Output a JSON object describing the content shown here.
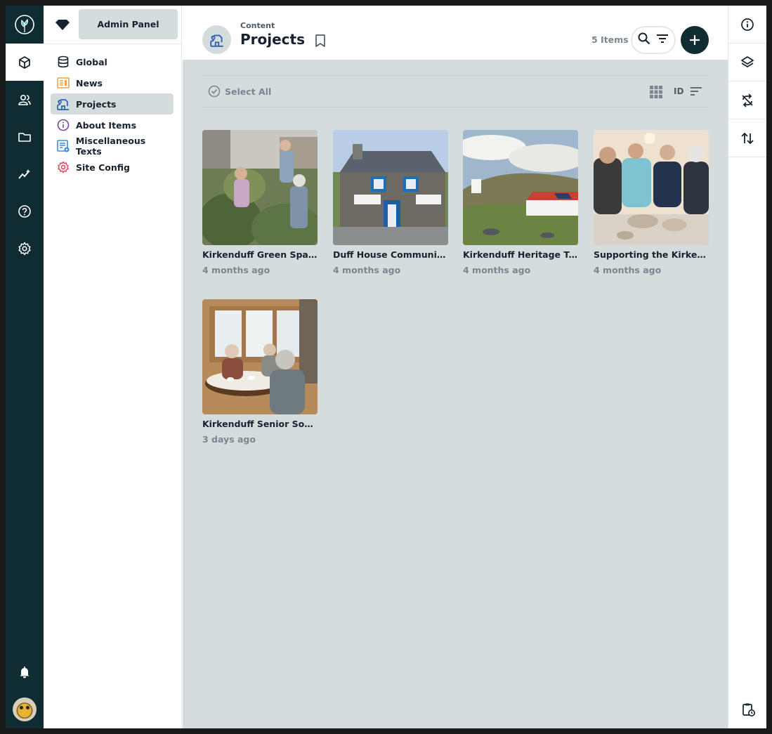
{
  "nav": {
    "admin_button": "Admin Panel",
    "items": [
      {
        "label": "Global",
        "icon": "database-icon",
        "color": "#18222f"
      },
      {
        "label": "News",
        "icon": "newspaper-icon",
        "color": "#f0a442"
      },
      {
        "label": "Projects",
        "icon": "projects-icon",
        "color": "#2b62b5",
        "active": true
      },
      {
        "label": "About Items",
        "icon": "info-icon",
        "color": "#7b4a8e"
      },
      {
        "label": "Miscellaneous Texts",
        "icon": "article-icon",
        "color": "#3a8ee0"
      },
      {
        "label": "Site Config",
        "icon": "gear-icon",
        "color": "#e0455f"
      }
    ]
  },
  "header": {
    "breadcrumb": "Content",
    "title": "Projects",
    "item_count": "5 Items"
  },
  "toolbar": {
    "select_all": "Select All",
    "sort_field": "ID"
  },
  "cards": [
    {
      "name": "Kirkenduff Green Spac...",
      "date": "4 months ago",
      "scene": "garden"
    },
    {
      "name": "Duff House Community...",
      "date": "4 months ago",
      "scene": "house"
    },
    {
      "name": "Kirkenduff Heritage Tra...",
      "date": "4 months ago",
      "scene": "landscape"
    },
    {
      "name": "Supporting the Kirkend...",
      "date": "4 months ago",
      "scene": "pottery"
    },
    {
      "name": "Kirkenduff Senior Socia...",
      "date": "3 days ago",
      "scene": "tea"
    }
  ],
  "colors": {
    "module_bar": "#0f2c33",
    "background": "#d5dcde",
    "accent": "#0f2c33"
  }
}
